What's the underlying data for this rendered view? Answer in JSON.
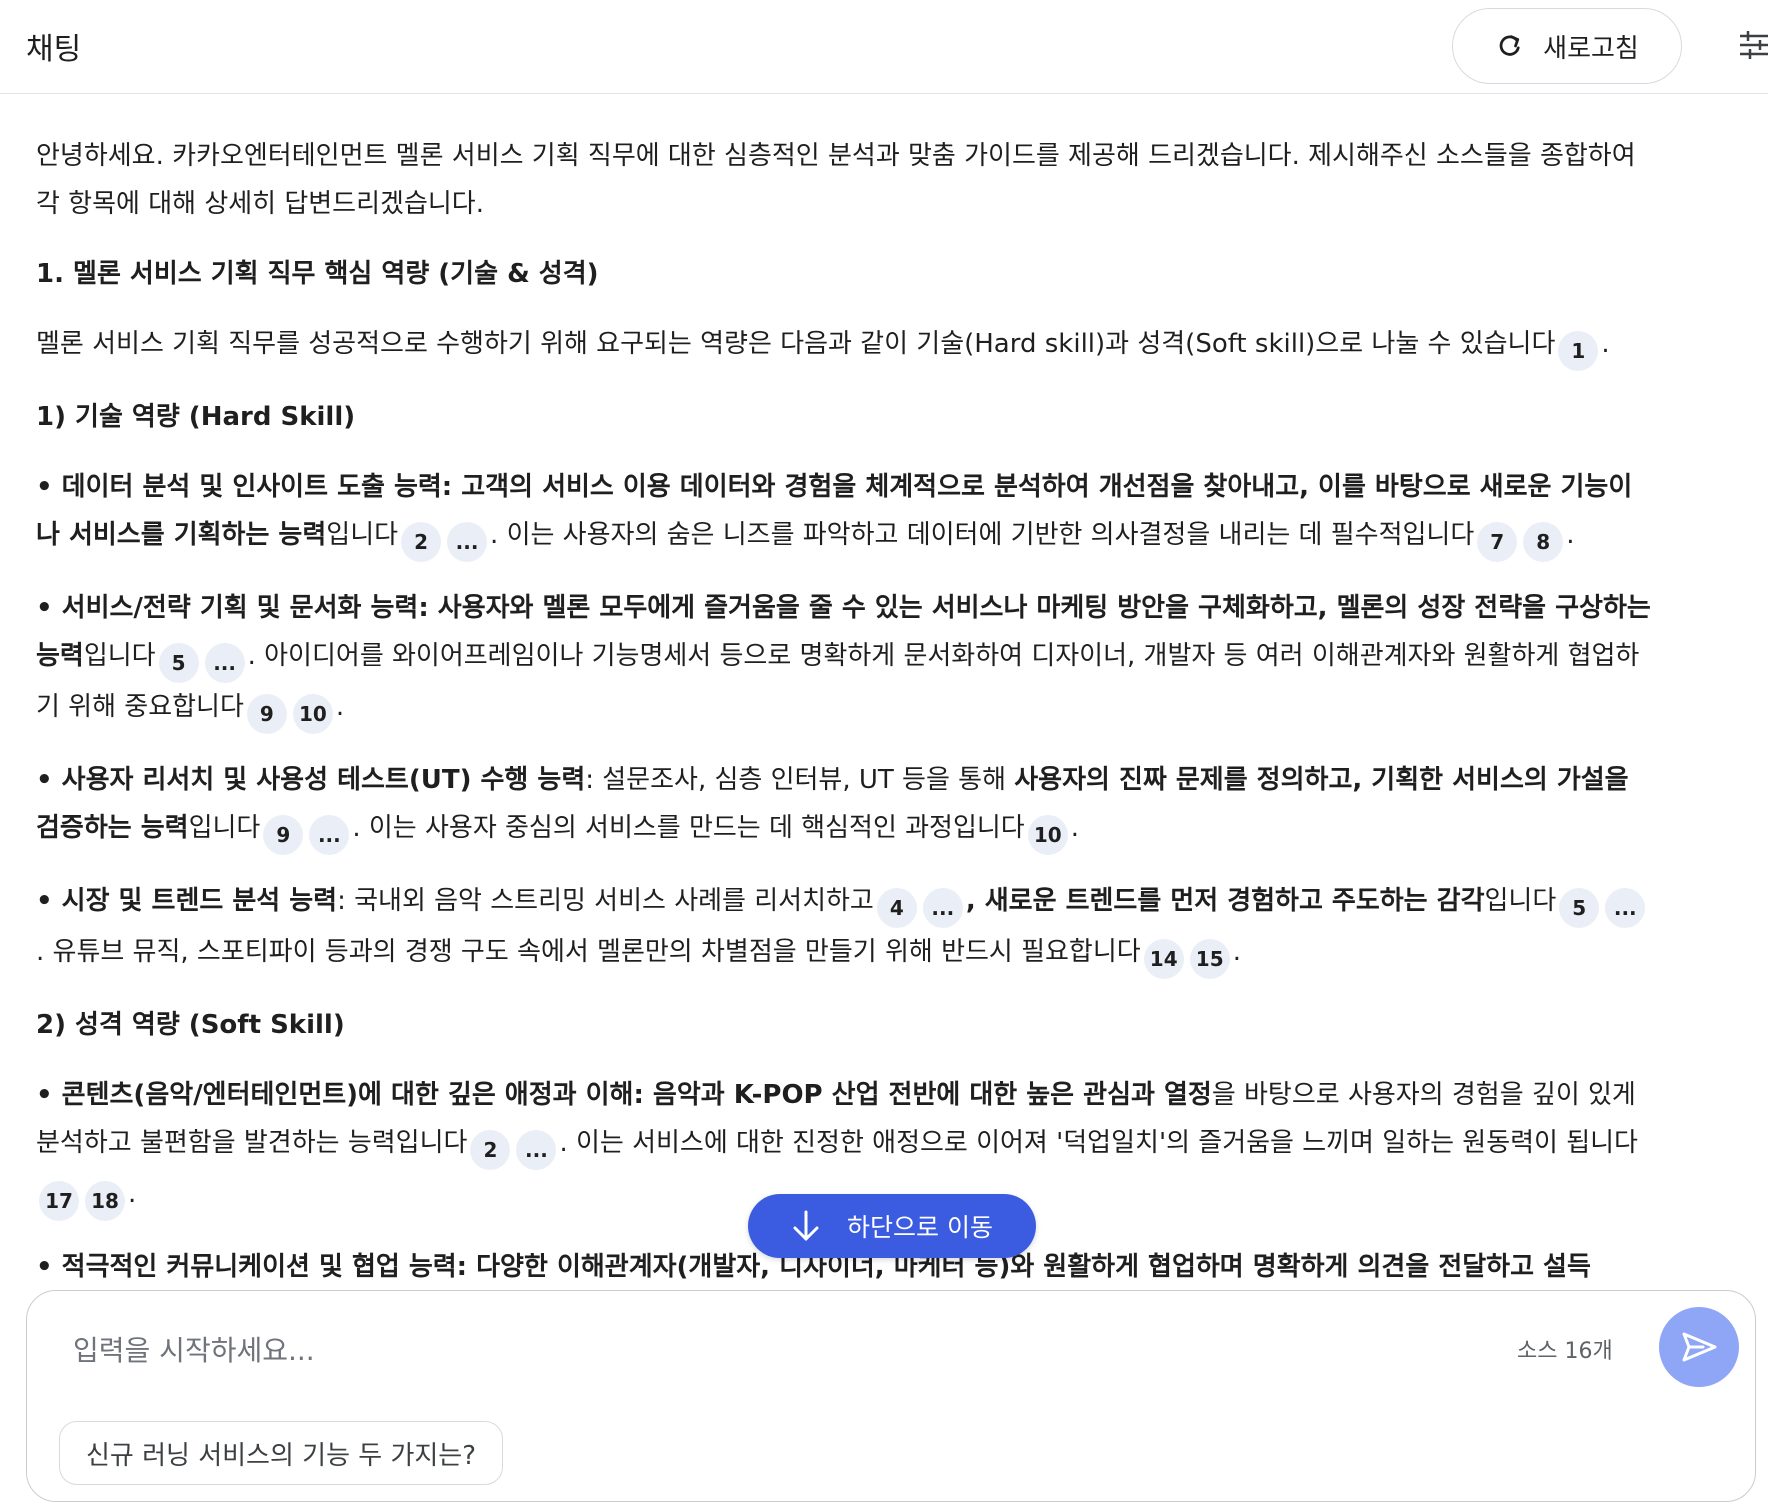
{
  "header": {
    "title": "채팅",
    "refresh_label": "새로고침"
  },
  "icons": {
    "refresh": "refresh-icon",
    "settings": "settings-sliders-icon",
    "jump": "arrow-down-icon",
    "send": "send-icon"
  },
  "colors": {
    "accent": "#3b5ce0",
    "send_button": "#8fa6f7",
    "citation_chip": "#eaeef6"
  },
  "message": {
    "intro": "안녕하세요. 카카오엔터테인먼트 멜론 서비스 기획 직무에 대한 심층적인 분석과 맞춤 가이드를 제공해 드리겠습니다. 제시해주신 소스들을 종합하여 각 항목에 대해 상세히 답변드리겠습니다.",
    "section1_heading": "1. 멜론 서비스 기획 직무 핵심 역량 (기술 & 성격)",
    "section1_text": "멜론 서비스 기획 직무를 성공적으로 수행하기 위해 요구되는 역량은 다음과 같이 기술(Hard skill)과 성격(Soft skill)으로 나눌 수 있습니다",
    "section1_cite": "1",
    "hard_heading": "1) 기술 역량 (Hard Skill)",
    "b1_bold": "• 데이터 분석 및 인사이트 도출 능력: 고객의 서비스 이용 데이터와 경험을 체계적으로 분석하여 개선점을 찾아내고, 이를 바탕으로 새로운 기능이나 서비스를 기획하는 능력",
    "b1_text1": "입니다",
    "b1_cite1": "2",
    "b1_more1": "...",
    "b1_text2": ". 이는 사용자의 숨은 니즈를 파악하고 데이터에 기반한 의사결정을 내리는 데 필수적입니다",
    "b1_cite2": "7",
    "b1_cite3": "8",
    "b2_bold": "• 서비스/전략 기획 및 문서화 능력: 사용자와 멜론 모두에게 즐거움을 줄 수 있는 서비스나 마케팅 방안을 구체화하고, 멜론의 성장 전략을 구상하는 능력",
    "b2_text1": "입니다",
    "b2_cite1": "5",
    "b2_more1": "...",
    "b2_text2": ". 아이디어를 와이어프레임이나 기능명세서 등으로 명확하게 문서화하여 디자이너, 개발자 등 여러 이해관계자와 원활하게 협업하기 위해 중요합니다",
    "b2_cite2": "9",
    "b2_cite3": "10",
    "b3_bold1": "• 사용자 리서치 및 사용성 테스트(UT) 수행 능력",
    "b3_text1": ": 설문조사, 심층 인터뷰, UT 등을 통해 ",
    "b3_bold2": "사용자의 진짜 문제를 정의하고, 기획한 서비스의 가설을 검증하는 능력",
    "b3_text2": "입니다",
    "b3_cite1": "9",
    "b3_more1": "...",
    "b3_text3": ". 이는 사용자 중심의 서비스를 만드는 데 핵심적인 과정입니다",
    "b3_cite2": "10",
    "b4_bold1": "• 시장 및 트렌드 분석 능력",
    "b4_text1": ": 국내외 음악 스트리밍 서비스 사례를 리서치하고",
    "b4_cite1": "4",
    "b4_more1": "...",
    "b4_bold2": ", 새로운 트렌드를 먼저 경험하고 주도하는 감각",
    "b4_text2": "입니다",
    "b4_cite2": "5",
    "b4_more2": "...",
    "b4_text3": ". 유튜브 뮤직, 스포티파이 등과의 경쟁 구도 속에서 멜론만의 차별점을 만들기 위해 반드시 필요합니다",
    "b4_cite3": "14",
    "b4_cite4": "15",
    "soft_heading": "2) 성격 역량 (Soft Skill)",
    "b5_bold1": "• 콘텐츠(음악/엔터테인먼트)에 대한 깊은 애정과 이해: 음악과 K-POP 산업 전반에 대한 높은 관심과 열정",
    "b5_text1": "을 바탕으로 사용자의 경험을 깊이 있게 분석하고 불편함을 발견하는 능력입니다",
    "b5_cite1": "2",
    "b5_more1": "...",
    "b5_text2": ". 이는 서비스에 대한 진정한 애정으로 이어져 '덕업일치'의 즐거움을 느끼며 일하는 원동력이 됩니다",
    "b5_cite2": "17",
    "b5_cite3": "18",
    "b6_bold1": "• 적극적인 커뮤니케이션 및 협업 능력: 다양한 이해관계자(개발자, 디자이너, 마케터 등)와 원활하게 협업하며 명확하게 의견을 전달하고 설득"
  },
  "jump_button": {
    "label": "하단으로 이동"
  },
  "input": {
    "placeholder": "입력을 시작하세요...",
    "source_count": "소스 16개",
    "suggestion": "신규 러닝 서비스의 기능 두 가지는?"
  }
}
